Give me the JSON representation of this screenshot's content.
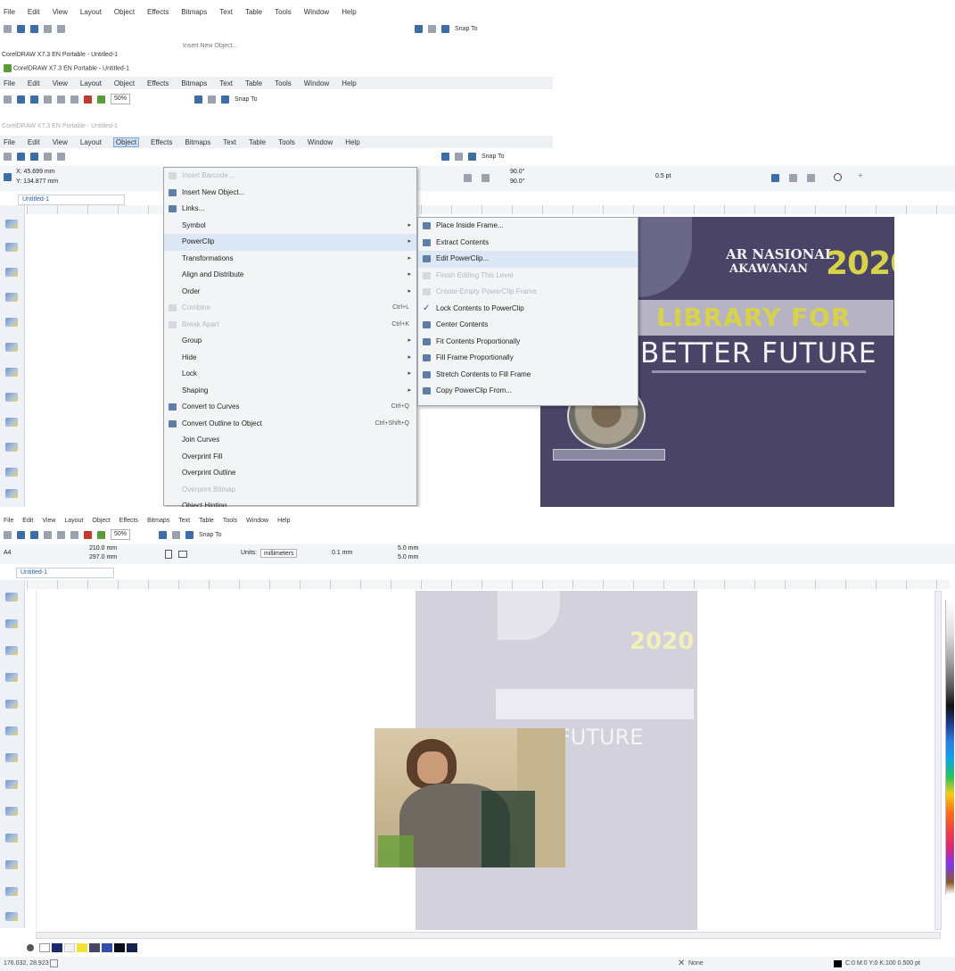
{
  "top_window": {
    "menubar": [
      "File",
      "Edit",
      "View",
      "Layout",
      "Object",
      "Effects",
      "Bitmaps",
      "Text",
      "Table",
      "Tools",
      "Window",
      "Help"
    ],
    "toolbar": {
      "snap_to": "Snap To"
    },
    "faded_menu_item": "Insert New Object...",
    "title_line_1": "CorelDRAW X7.3 EN Portable - Untitled-1",
    "title_line_2": "CorelDRAW X7.3 EN Portable - Untitled-1",
    "second_menubar": [
      "File",
      "Edit",
      "View",
      "Layout",
      "Object",
      "Effects",
      "Bitmaps",
      "Text",
      "Table",
      "Tools",
      "Window",
      "Help"
    ],
    "second_toolbar": {
      "zoom": "50%",
      "snap_to": "Snap To"
    },
    "third_title": "CorelDRAW X7.3 EN Portable - Untitled-1",
    "third_menubar": [
      "File",
      "Edit",
      "View",
      "Layout",
      "Object",
      "Effects",
      "Bitmaps",
      "Text",
      "Table",
      "Tools",
      "Window",
      "Help"
    ],
    "property_bar": {
      "x": "X: 45.699 mm",
      "y": "Y: 134.877 mm",
      "angle1": "90.0°",
      "angle2": "90.0°",
      "outline": "0.5 pt",
      "snap_to": "Snap To"
    },
    "doc_tab": "Untitled-1"
  },
  "object_menu": [
    {
      "label": "Insert Barcode...",
      "disabled": true,
      "icon": "barcode-icon"
    },
    {
      "label": "Insert New Object...",
      "icon": "new-object-icon"
    },
    {
      "label": "Links...",
      "icon": "link-icon"
    },
    {
      "label": "Symbol",
      "submenu": true
    },
    {
      "label": "PowerClip",
      "submenu": true,
      "highlighted": true
    },
    {
      "label": "Transformations",
      "submenu": true
    },
    {
      "label": "Align and Distribute",
      "submenu": true
    },
    {
      "label": "Order",
      "submenu": true
    },
    {
      "label": "Combine",
      "disabled": true,
      "shortcut": "Ctrl+L",
      "icon": "combine-icon"
    },
    {
      "label": "Break Apart",
      "disabled": true,
      "shortcut": "Ctrl+K",
      "icon": "break-apart-icon"
    },
    {
      "label": "Group",
      "submenu": true
    },
    {
      "label": "Hide",
      "submenu": true
    },
    {
      "label": "Lock",
      "submenu": true
    },
    {
      "label": "Shaping",
      "submenu": true
    },
    {
      "label": "Convert to Curves",
      "shortcut": "Ctrl+Q",
      "icon": "convert-curves-icon"
    },
    {
      "label": "Convert Outline to Object",
      "shortcut": "Ctrl+Shift+Q",
      "icon": "convert-outline-icon"
    },
    {
      "label": "Join Curves"
    },
    {
      "label": "Overprint Fill"
    },
    {
      "label": "Overprint Outline"
    },
    {
      "label": "Overprint Bitmap",
      "disabled": true
    },
    {
      "label": "Object Hinting"
    }
  ],
  "powerclip_menu": [
    {
      "label": "Place Inside Frame...",
      "icon": "place-inside-icon"
    },
    {
      "label": "Extract Contents",
      "icon": "extract-icon"
    },
    {
      "label": "Edit PowerClip...",
      "highlighted": true,
      "icon": "edit-powerclip-icon"
    },
    {
      "label": "Finish Editing This Level",
      "disabled": true,
      "icon": "finish-edit-icon"
    },
    {
      "label": "Create Empty PowerClip Frame",
      "disabled": true,
      "icon": "empty-frame-icon"
    },
    {
      "label": "Lock Contents to PowerClip",
      "checked": true,
      "icon": "check-icon"
    },
    {
      "label": "Center Contents",
      "icon": "center-icon"
    },
    {
      "label": "Fit Contents Proportionally",
      "icon": "fit-prop-icon"
    },
    {
      "label": "Fill Frame Proportionally",
      "icon": "fill-frame-icon"
    },
    {
      "label": "Stretch Contents to Fill Frame",
      "icon": "stretch-icon"
    },
    {
      "label": "Copy PowerClip From...",
      "icon": "copy-powerclip-icon"
    }
  ],
  "poster": {
    "line1": "AR NASIONAL",
    "line2": "AKAWANAN",
    "year": "2020",
    "banner": "LIBRARY FOR",
    "line3": "BETTER FUTURE",
    "bg": "#4a4566",
    "accent": "#d8d24a"
  },
  "bottom_window": {
    "menubar": [
      "File",
      "Edit",
      "View",
      "Layout",
      "Object",
      "Effects",
      "Bitmaps",
      "Text",
      "Table",
      "Tools",
      "Window",
      "Help"
    ],
    "toolbar": {
      "zoom": "50%",
      "snap_to": "Snap To"
    },
    "property_bar": {
      "page_size": "A4",
      "width": "210.0 mm",
      "height": "297.0 mm",
      "units_label": "Units:",
      "units": "millimeters",
      "nudge": "0.1 mm",
      "dup_x": "5.0 mm",
      "dup_y": "5.0 mm"
    },
    "doc_tab": "Untitled-1",
    "status_left": "176.032, 28.923",
    "status_fill": "None",
    "status_right": "C:0 M:0 Y:0 K:100 0.500 pt"
  }
}
